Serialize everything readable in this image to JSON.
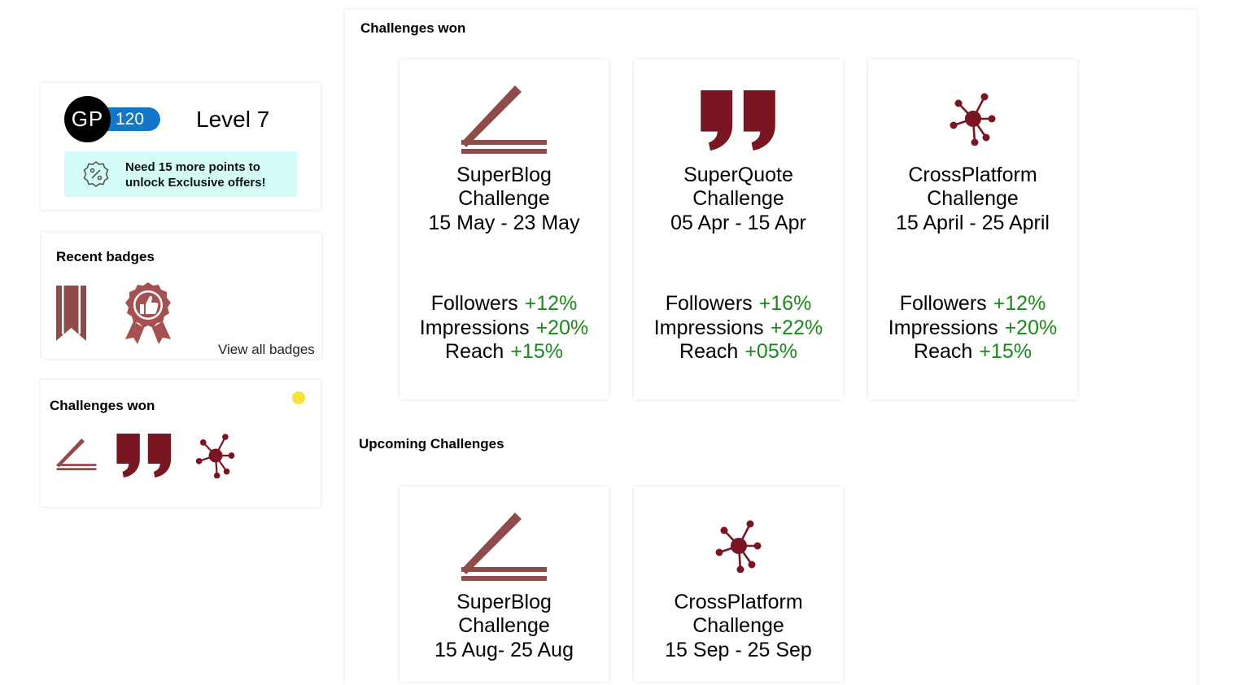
{
  "colors": {
    "accent_blue": "#1376c6",
    "brand_maroon": "#7a1522",
    "muted_maroon": "#8f4a4a",
    "positive_green": "#1a8a1a",
    "offer_bg": "#d5fdf8",
    "notification_yellow": "#f4e43a"
  },
  "profile": {
    "initials": "GP",
    "points": "120",
    "level": "Level 7",
    "offer_line1": "Need 15 more points to",
    "offer_line2": "unlock Exclusive offers!",
    "offer_icon": "discount-badge-icon"
  },
  "recent_badges": {
    "title": "Recent badges",
    "view_all": "View all badges",
    "badges": [
      "bookmark-icon",
      "thumbs-up-award-icon"
    ]
  },
  "challenges_won_small": {
    "title": "Challenges  won",
    "icons": [
      "blog-pen-icon",
      "quote-icon",
      "network-icon"
    ]
  },
  "main": {
    "won_title": "Challenges  won",
    "upcoming_title": "Upcoming Challenges",
    "won": [
      {
        "icon": "blog-pen-icon",
        "name": "SuperBlog",
        "subtitle": "Challenge",
        "dates": "15 May - 23 May",
        "stats": [
          {
            "label": "Followers",
            "value": "+12%"
          },
          {
            "label": "Impressions",
            "value": "+20%"
          },
          {
            "label": "Reach",
            "value": "+15%"
          }
        ]
      },
      {
        "icon": "quote-icon",
        "name": "SuperQuote",
        "subtitle": "Challenge",
        "dates": "05 Apr - 15 Apr",
        "stats": [
          {
            "label": "Followers",
            "value": "+16%"
          },
          {
            "label": "Impressions",
            "value": "+22%"
          },
          {
            "label": "Reach",
            "value": "+05%"
          }
        ]
      },
      {
        "icon": "network-icon",
        "name": "CrossPlatform",
        "subtitle": "Challenge",
        "dates": "15 April - 25 April",
        "stats": [
          {
            "label": "Followers",
            "value": "+12%"
          },
          {
            "label": "Impressions",
            "value": "+20%"
          },
          {
            "label": "Reach",
            "value": "+15%"
          }
        ]
      }
    ],
    "upcoming": [
      {
        "icon": "blog-pen-icon",
        "name": "SuperBlog",
        "subtitle": "Challenge",
        "dates": "15 Aug- 25 Aug"
      },
      {
        "icon": "network-icon",
        "name": "CrossPlatform",
        "subtitle": "Challenge",
        "dates": "15 Sep - 25 Sep"
      }
    ]
  }
}
